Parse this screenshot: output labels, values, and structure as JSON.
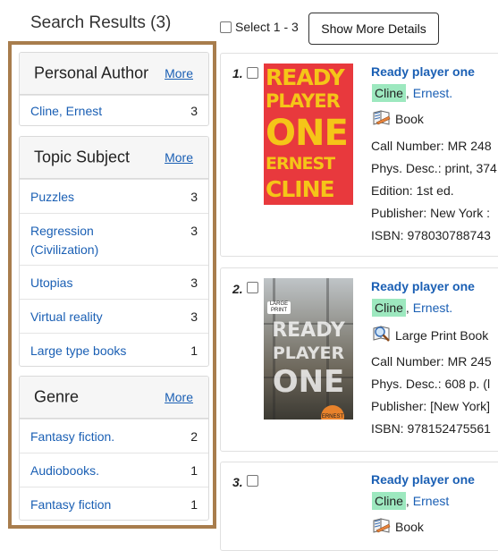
{
  "header": {
    "results_heading": "Search Results (3)",
    "select_label": "Select 1 - 3",
    "more_details_label": "Show More Details"
  },
  "facets": [
    {
      "title": "Personal Author",
      "more": "More",
      "items": [
        {
          "label": "Cline, Ernest",
          "count": "3"
        }
      ]
    },
    {
      "title": "Topic Subject",
      "more": "More",
      "items": [
        {
          "label": "Puzzles",
          "count": "3"
        },
        {
          "label": "Regression (Civilization)",
          "count": "3"
        },
        {
          "label": "Utopias",
          "count": "3"
        },
        {
          "label": "Virtual reality",
          "count": "3"
        },
        {
          "label": "Large type books",
          "count": "1"
        }
      ]
    },
    {
      "title": "Genre",
      "more": "More",
      "items": [
        {
          "label": "Fantasy fiction.",
          "count": "2"
        },
        {
          "label": "Audiobooks.",
          "count": "1"
        },
        {
          "label": "Fantasy fiction",
          "count": "1"
        }
      ]
    }
  ],
  "results": [
    {
      "number": "1.",
      "title": "Ready player one",
      "author_highlight": "Cline",
      "author_rest": "Ernest.",
      "format": "Book",
      "format_icon": "book-icon",
      "cover_text": [
        "READY",
        "PLAYER",
        "ONE",
        "ERNEST",
        "CLINE"
      ],
      "details": [
        "Call Number: MR 248",
        "Phys. Desc.: print, 374",
        "Edition: 1st ed.",
        "Publisher: New York :",
        "ISBN: 978030788743"
      ]
    },
    {
      "number": "2.",
      "title": "Ready player one",
      "author_highlight": "Cline",
      "author_rest": "Ernest.",
      "format": "Large Print Book",
      "format_icon": "large-print-book-icon",
      "cover_text": [
        "READY",
        "PLAYER",
        "ONE"
      ],
      "cover_badge": "LARGE PRINT",
      "cover_author": "ERNEST CLINE",
      "details": [
        "Call Number: MR 245",
        "Phys. Desc.: 608 p. (l",
        "Publisher: [New York]",
        "ISBN: 978152475561"
      ]
    },
    {
      "number": "3.",
      "title": "Ready player one",
      "author_highlight": "Cline",
      "author_rest": "Ernest",
      "format": "Book",
      "format_icon": "book-icon",
      "details": []
    }
  ],
  "colors": {
    "link": "#1a5fb4",
    "highlight": "#9de8bf",
    "sidebar_border": "#a87d4d"
  }
}
